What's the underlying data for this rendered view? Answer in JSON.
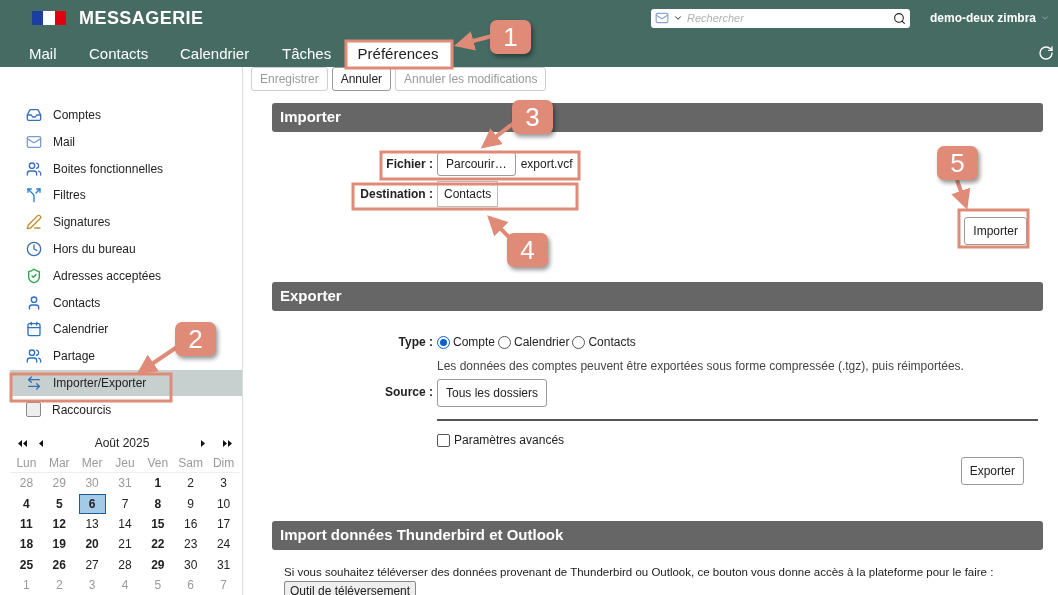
{
  "header": {
    "title": "MESSAGERIE",
    "search": {
      "placeholder": "Rechercher"
    },
    "user": "demo-deux zimbra"
  },
  "tabs": [
    {
      "label": "Mail",
      "selected": false
    },
    {
      "label": "Contacts",
      "selected": false
    },
    {
      "label": "Calendrier",
      "selected": false
    },
    {
      "label": "Tâches",
      "selected": false
    },
    {
      "label": "Préférences",
      "selected": true
    }
  ],
  "toolbar": [
    {
      "label": "Enregistrer",
      "disabled": true
    },
    {
      "label": "Annuler",
      "disabled": false
    },
    {
      "label": "Annuler les modifications",
      "disabled": true
    }
  ],
  "sidebar": {
    "items": [
      {
        "label": "Comptes",
        "selected": false
      },
      {
        "label": "Mail",
        "selected": false
      },
      {
        "label": "Boites fonctionnelles",
        "selected": false
      },
      {
        "label": "Filtres",
        "selected": false
      },
      {
        "label": "Signatures",
        "selected": false
      },
      {
        "label": "Hors du bureau",
        "selected": false
      },
      {
        "label": "Adresses acceptées",
        "selected": false
      },
      {
        "label": "Contacts",
        "selected": false
      },
      {
        "label": "Calendrier",
        "selected": false
      },
      {
        "label": "Partage",
        "selected": false
      },
      {
        "label": "Importer/Exporter",
        "selected": true
      },
      {
        "label": "Raccourcis",
        "selected": false
      }
    ]
  },
  "calendar": {
    "month": "Août 2025",
    "weekdays": [
      "Lun",
      "Mar",
      "Mer",
      "Jeu",
      "Ven",
      "Sam",
      "Dim"
    ],
    "days": [
      {
        "label": "28",
        "muted": true,
        "bold": false,
        "selected": false
      },
      {
        "label": "29",
        "muted": true,
        "bold": false,
        "selected": false
      },
      {
        "label": "30",
        "muted": true,
        "bold": false,
        "selected": false
      },
      {
        "label": "31",
        "muted": true,
        "bold": false,
        "selected": false
      },
      {
        "label": "1",
        "muted": false,
        "bold": true,
        "selected": false
      },
      {
        "label": "2",
        "muted": false,
        "bold": false,
        "selected": false
      },
      {
        "label": "3",
        "muted": false,
        "bold": false,
        "selected": false
      },
      {
        "label": "4",
        "muted": false,
        "bold": true,
        "selected": false
      },
      {
        "label": "5",
        "muted": false,
        "bold": true,
        "selected": false
      },
      {
        "label": "6",
        "muted": false,
        "bold": true,
        "selected": true
      },
      {
        "label": "7",
        "muted": false,
        "bold": false,
        "selected": false
      },
      {
        "label": "8",
        "muted": false,
        "bold": true,
        "selected": false
      },
      {
        "label": "9",
        "muted": false,
        "bold": false,
        "selected": false
      },
      {
        "label": "10",
        "muted": false,
        "bold": false,
        "selected": false
      },
      {
        "label": "11",
        "muted": false,
        "bold": true,
        "selected": false
      },
      {
        "label": "12",
        "muted": false,
        "bold": true,
        "selected": false
      },
      {
        "label": "13",
        "muted": false,
        "bold": false,
        "selected": false
      },
      {
        "label": "14",
        "muted": false,
        "bold": false,
        "selected": false
      },
      {
        "label": "15",
        "muted": false,
        "bold": true,
        "selected": false
      },
      {
        "label": "16",
        "muted": false,
        "bold": false,
        "selected": false
      },
      {
        "label": "17",
        "muted": false,
        "bold": false,
        "selected": false
      },
      {
        "label": "18",
        "muted": false,
        "bold": true,
        "selected": false
      },
      {
        "label": "19",
        "muted": false,
        "bold": true,
        "selected": false
      },
      {
        "label": "20",
        "muted": false,
        "bold": true,
        "selected": false
      },
      {
        "label": "21",
        "muted": false,
        "bold": false,
        "selected": false
      },
      {
        "label": "22",
        "muted": false,
        "bold": true,
        "selected": false
      },
      {
        "label": "23",
        "muted": false,
        "bold": false,
        "selected": false
      },
      {
        "label": "24",
        "muted": false,
        "bold": false,
        "selected": false
      },
      {
        "label": "25",
        "muted": false,
        "bold": true,
        "selected": false
      },
      {
        "label": "26",
        "muted": false,
        "bold": true,
        "selected": false
      },
      {
        "label": "27",
        "muted": false,
        "bold": false,
        "selected": false
      },
      {
        "label": "28",
        "muted": false,
        "bold": false,
        "selected": false
      },
      {
        "label": "29",
        "muted": false,
        "bold": true,
        "selected": false
      },
      {
        "label": "30",
        "muted": false,
        "bold": false,
        "selected": false
      },
      {
        "label": "31",
        "muted": false,
        "bold": false,
        "selected": false
      },
      {
        "label": "1",
        "muted": true,
        "bold": false,
        "selected": false
      },
      {
        "label": "2",
        "muted": true,
        "bold": false,
        "selected": false
      },
      {
        "label": "3",
        "muted": true,
        "bold": false,
        "selected": false
      },
      {
        "label": "4",
        "muted": true,
        "bold": false,
        "selected": false
      },
      {
        "label": "5",
        "muted": true,
        "bold": false,
        "selected": false
      },
      {
        "label": "6",
        "muted": true,
        "bold": false,
        "selected": false
      },
      {
        "label": "7",
        "muted": true,
        "bold": false,
        "selected": false
      }
    ]
  },
  "import": {
    "title": "Importer",
    "file": {
      "label": "Fichier :",
      "button": "Parcourir…",
      "filename": "export.vcf"
    },
    "destination": {
      "label": "Destination :",
      "value": "Contacts"
    },
    "button": "Importer"
  },
  "export": {
    "title": "Exporter",
    "type_label": "Type :",
    "types": [
      {
        "label": "Compte",
        "selected": true
      },
      {
        "label": "Calendrier",
        "selected": false
      },
      {
        "label": "Contacts",
        "selected": false
      }
    ],
    "description": "Les données des comptes peuvent être exportées sous forme compressée (.tgz), puis réimportées.",
    "source_label": "Source :",
    "source_button": "Tous les dossiers",
    "advanced": {
      "label": "Paramètres avancés",
      "checked": false
    },
    "button": "Exporter"
  },
  "thunderbird": {
    "title": "Import données Thunderbird et Outlook",
    "text": "Si vous souhaitez téléverser des données provenant de Thunderbird ou Outlook, ce bouton vous donne accès à la plateforme pour le faire :",
    "button": "Outil de téléversement"
  },
  "callouts": [
    {
      "label": "1"
    },
    {
      "label": "2"
    },
    {
      "label": "3"
    },
    {
      "label": "4"
    },
    {
      "label": "5"
    }
  ]
}
